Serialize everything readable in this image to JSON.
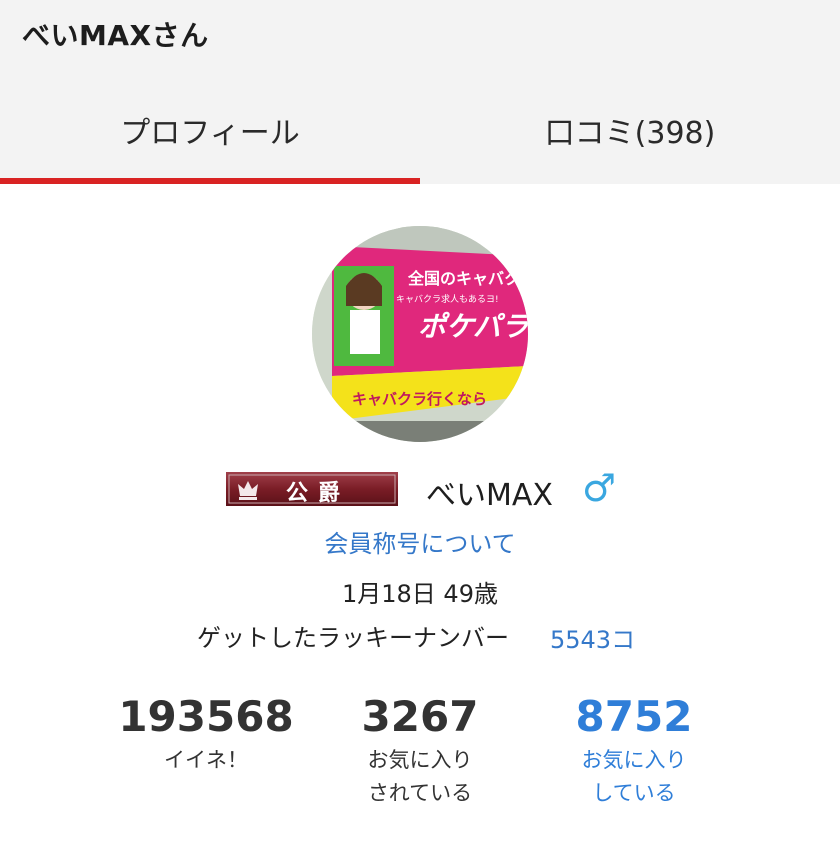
{
  "header": {
    "title": "べいMAXさん"
  },
  "tabs": [
    {
      "label": "プロフィール",
      "active": true
    },
    {
      "label": "口コミ(398)",
      "active": false
    }
  ],
  "colors": {
    "accent": "#d92323",
    "link": "#3578c9",
    "highlight": "#2f7ed8",
    "male": "#3aa7e0"
  },
  "profile": {
    "avatar_texts": [
      "全国のキャバクラ",
      "ポケパラ",
      "キャバクラ求人もあるヨ!",
      "キャバクラ行くなら"
    ],
    "rank": "公爵",
    "name": "べいMAX",
    "gender_icon": "male-icon",
    "gender_symbol": "♂",
    "title_link": "会員称号について",
    "birthday": "1月18日 49歳",
    "lucky_label": "ゲットしたラッキーナンバー",
    "lucky_count": "5543コ"
  },
  "stats": [
    {
      "value": "193568",
      "label_1": "イイネ！",
      "label_2": ""
    },
    {
      "value": "3267",
      "label_1": "お気に入り",
      "label_2": "されている"
    },
    {
      "value": "8752",
      "label_1": "お気に入り",
      "label_2": "している"
    }
  ]
}
